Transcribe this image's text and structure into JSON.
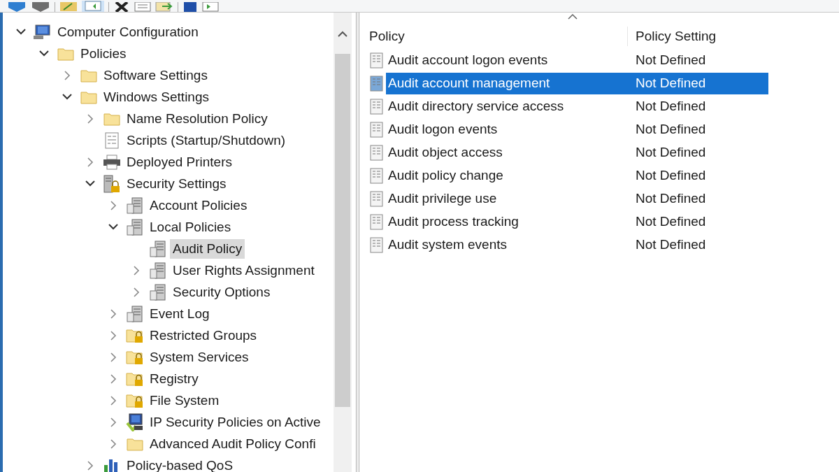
{
  "tree": [
    {
      "label": "Computer Configuration",
      "kind": "computer",
      "expanded": true,
      "selected": false,
      "children": [
        {
          "label": "Policies",
          "kind": "folder",
          "expanded": true,
          "selected": false,
          "children": [
            {
              "label": "Software Settings",
              "kind": "folder",
              "expanded": false,
              "selected": false
            },
            {
              "label": "Windows Settings",
              "kind": "folder",
              "expanded": true,
              "selected": false,
              "children": [
                {
                  "label": "Name Resolution Policy",
                  "kind": "folder",
                  "expanded": false,
                  "selected": false
                },
                {
                  "label": "Scripts (Startup/Shutdown)",
                  "kind": "script",
                  "selected": false
                },
                {
                  "label": "Deployed Printers",
                  "kind": "printer",
                  "expanded": false,
                  "selected": false
                },
                {
                  "label": "Security Settings",
                  "kind": "security",
                  "expanded": true,
                  "selected": false,
                  "children": [
                    {
                      "label": "Account Policies",
                      "kind": "policy",
                      "expanded": false,
                      "selected": false
                    },
                    {
                      "label": "Local Policies",
                      "kind": "policy",
                      "expanded": true,
                      "selected": false,
                      "children": [
                        {
                          "label": "Audit Policy",
                          "kind": "policy",
                          "selected": true
                        },
                        {
                          "label": "User Rights Assignment",
                          "kind": "policy",
                          "expanded": false,
                          "selected": false
                        },
                        {
                          "label": "Security Options",
                          "kind": "policy",
                          "expanded": false,
                          "selected": false
                        }
                      ]
                    },
                    {
                      "label": "Event Log",
                      "kind": "policy",
                      "expanded": false,
                      "selected": false
                    },
                    {
                      "label": "Restricted Groups",
                      "kind": "lockfolder",
                      "expanded": false,
                      "selected": false
                    },
                    {
                      "label": "System Services",
                      "kind": "lockfolder",
                      "expanded": false,
                      "selected": false
                    },
                    {
                      "label": "Registry",
                      "kind": "lockfolder",
                      "expanded": false,
                      "selected": false
                    },
                    {
                      "label": "File System",
                      "kind": "lockfolder",
                      "expanded": false,
                      "selected": false
                    },
                    {
                      "label": "IP Security Policies on Active",
                      "kind": "ipsec",
                      "expanded": false,
                      "selected": false
                    },
                    {
                      "label": "Advanced Audit Policy Confi",
                      "kind": "folder",
                      "expanded": false,
                      "selected": false
                    }
                  ]
                },
                {
                  "label": "Policy-based QoS",
                  "kind": "chart",
                  "expanded": false,
                  "selected": false
                }
              ]
            }
          ]
        }
      ]
    }
  ],
  "list": {
    "columns": [
      "Policy",
      "Policy Setting"
    ],
    "rows": [
      {
        "policy": "Audit account logon events",
        "setting": "Not Defined",
        "selected": false
      },
      {
        "policy": "Audit account management",
        "setting": "Not Defined",
        "selected": true
      },
      {
        "policy": "Audit directory service access",
        "setting": "Not Defined",
        "selected": false
      },
      {
        "policy": "Audit logon events",
        "setting": "Not Defined",
        "selected": false
      },
      {
        "policy": "Audit object access",
        "setting": "Not Defined",
        "selected": false
      },
      {
        "policy": "Audit policy change",
        "setting": "Not Defined",
        "selected": false
      },
      {
        "policy": "Audit privilege use",
        "setting": "Not Defined",
        "selected": false
      },
      {
        "policy": "Audit process tracking",
        "setting": "Not Defined",
        "selected": false
      },
      {
        "policy": "Audit system events",
        "setting": "Not Defined",
        "selected": false
      }
    ]
  }
}
